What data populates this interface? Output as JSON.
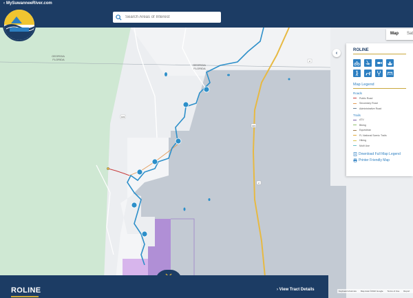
{
  "header": {
    "site_link": "MySuwanneeRiver.com",
    "search_placeholder": "Search Areas of Interest"
  },
  "map_toggle": {
    "active": "Map",
    "inactive": "Sat"
  },
  "map_labels": {
    "georgia": "GEORGIA",
    "florida": "FLORIDA",
    "georgia_florida": "GEORGIA\nFLORIDA",
    "road_133": "133",
    "road_2": "2",
    "road_133b": "133",
    "road_2b": "2"
  },
  "panel": {
    "collapse": "‹",
    "title": "ROLINE",
    "activities": [
      "bike-icon",
      "canoe-icon",
      "fishing-icon",
      "boat-icon",
      "hiking-icon",
      "horse-icon",
      "hunting-icon",
      "picnic-icon"
    ],
    "legend_title": "Map Legend",
    "roads_label": "Roads",
    "roads": [
      {
        "name": "Public Road",
        "color": "#c83b3b"
      },
      {
        "name": "Secondary Road",
        "color": "#e39a55"
      },
      {
        "name": "Administrative Road",
        "color": "#6b7f95"
      }
    ],
    "trails_label": "Trails",
    "trails": [
      {
        "name": "ATV",
        "color": "#7a5fa8"
      },
      {
        "name": "Biking",
        "color": "#8fbf6a"
      },
      {
        "name": "Equestrian",
        "color": "#a37c4d"
      },
      {
        "name": "FL National Scenic Trails",
        "color": "#e2a93a"
      },
      {
        "name": "Hiking",
        "color": "#d8c34a"
      },
      {
        "name": "Multi Use",
        "color": "#66c0c9"
      }
    ],
    "download_link": "Download Full Map Legend",
    "print_link": "Printer Friendly Map"
  },
  "bottom": {
    "title": "ROLINE",
    "details_link": "View Tract Details"
  },
  "attribution": {
    "shortcuts": "Keyboard shortcuts",
    "data": "Map data ©2022 Google",
    "terms": "Terms of Use",
    "report": "Report"
  },
  "colors": {
    "header": "#1c3c64",
    "accent": "#c9a73a",
    "river": "#2d8fc9",
    "tract": "#c3cad3",
    "forest": "#cfe8d3"
  }
}
